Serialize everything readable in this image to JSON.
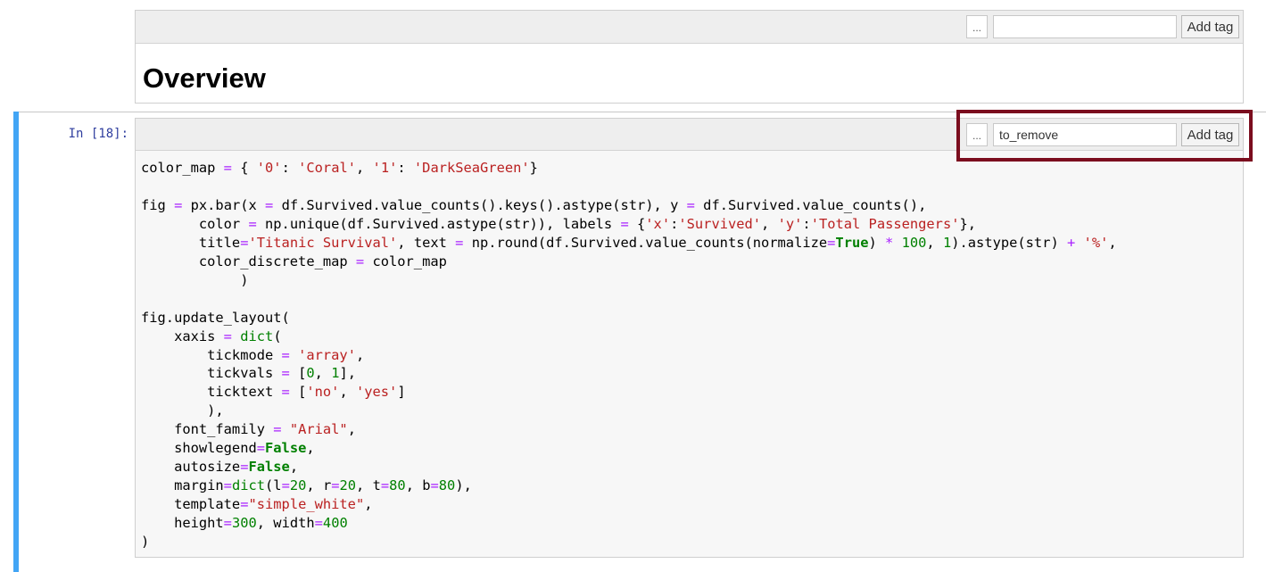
{
  "markdown_cell": {
    "tag_dots": "...",
    "tag_input_value": "",
    "add_tag_label": "Add tag",
    "heading": "Overview"
  },
  "code_cell": {
    "prompt": "In [18]:",
    "tag_dots": "...",
    "tag_input_value": "to_remove",
    "add_tag_label": "Add tag",
    "source": "color_map = { '0': 'Coral', '1': 'DarkSeaGreen'}\n\nfig = px.bar(x = df.Survived.value_counts().keys().astype(str), y = df.Survived.value_counts(),\n       color = np.unique(df.Survived.astype(str)), labels = {'x':'Survived', 'y':'Total Passengers'},\n       title='Titanic Survival', text = np.round(df.Survived.value_counts(normalize=True) * 100, 1).astype(str) + '%',\n       color_discrete_map = color_map\n            )\n\nfig.update_layout(\n    xaxis = dict(\n        tickmode = 'array',\n        tickvals = [0, 1],\n        ticktext = ['no', 'yes']\n        ),\n    font_family = \"Arial\",\n    showlegend=False,\n    autosize=False,\n    margin=dict(l=20, r=20, t=80, b=80),\n    template=\"simple_white\",\n    height=300, width=400\n)"
  },
  "colors": {
    "selection_bar": "#42a5f5",
    "highlight_box": "#7b0d1e",
    "prompt": "#303f9f",
    "string": "#ba2121",
    "keyword": "#008000",
    "operator": "#aa22ff"
  }
}
